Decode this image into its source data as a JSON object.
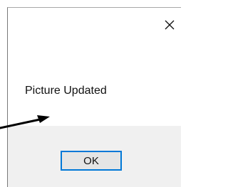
{
  "dialog": {
    "message": "Picture Updated",
    "ok_label": "OK",
    "close_glyph": "✕"
  },
  "icons": {
    "close": "close-icon",
    "annotation": "arrow-annotation"
  },
  "colors": {
    "button_focus_border": "#0078d7",
    "footer_bg": "#f0f0f0",
    "button_bg": "#e5e5e5"
  }
}
